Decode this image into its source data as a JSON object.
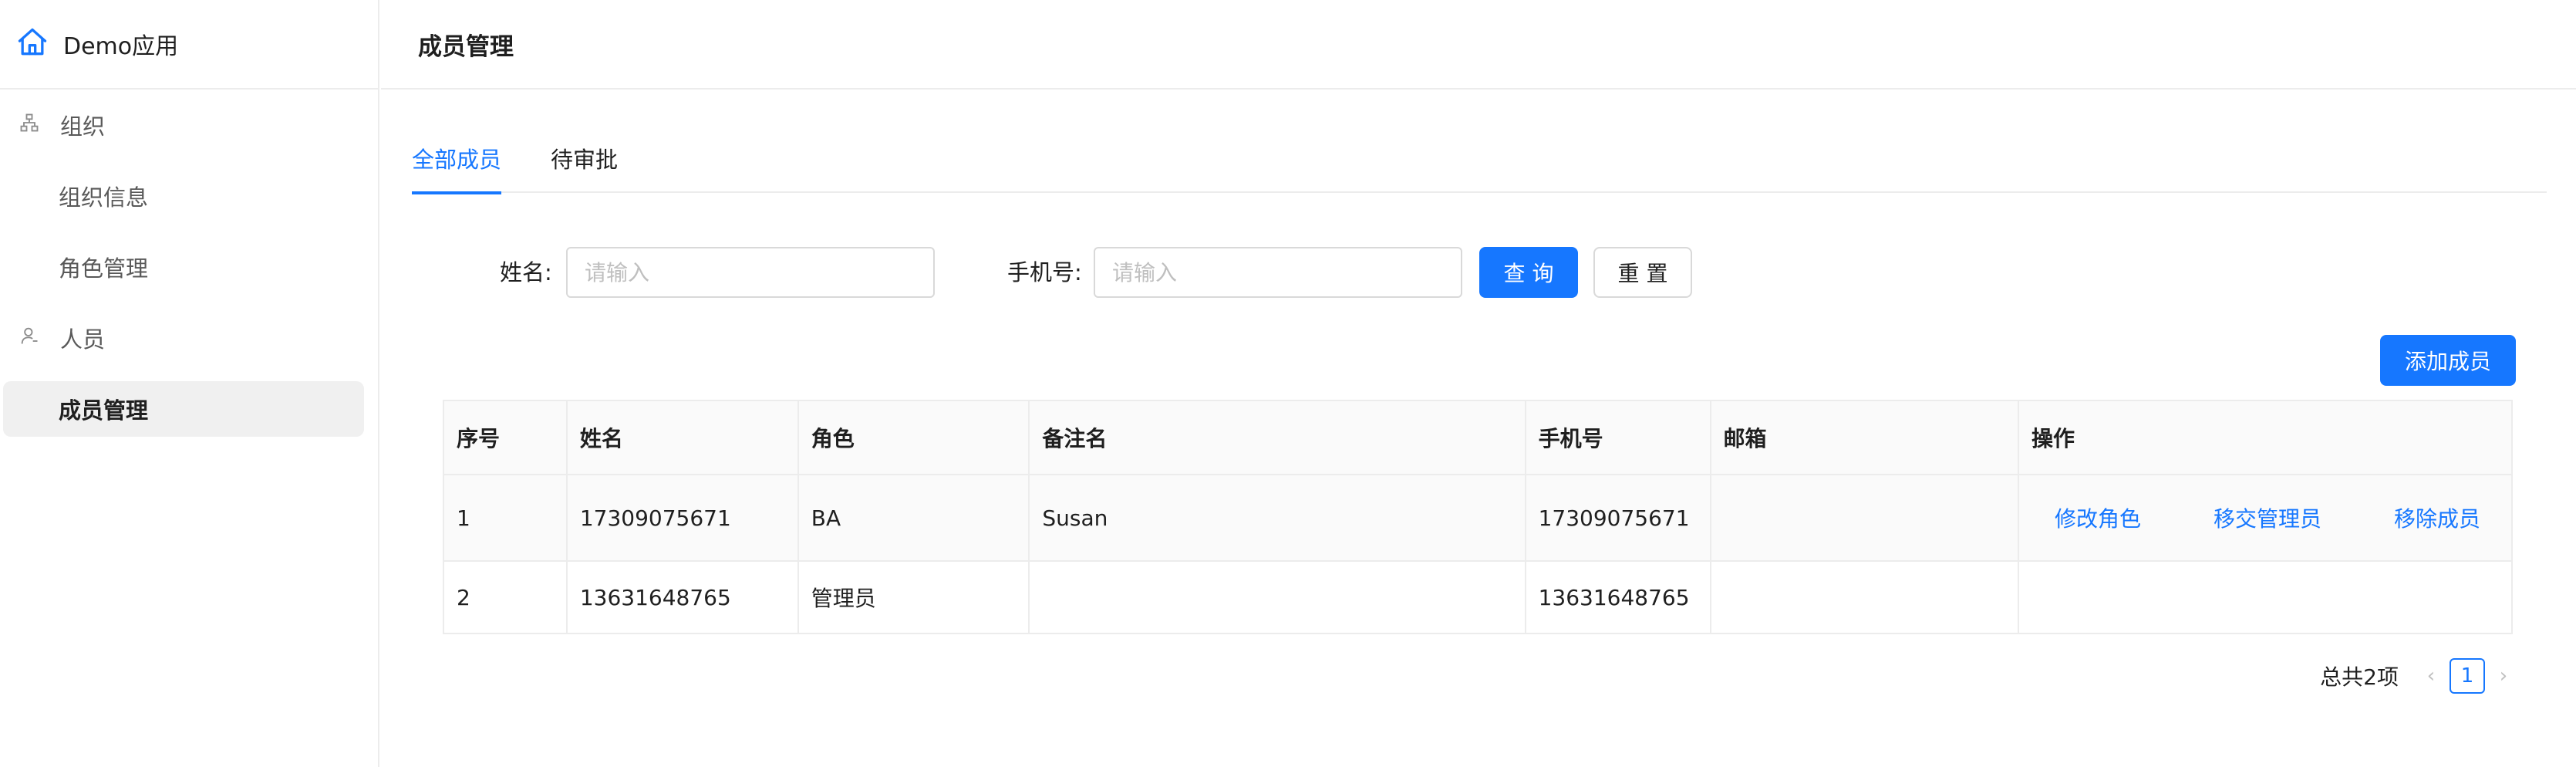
{
  "app": {
    "name": "Demo应用",
    "home_icon": "home-icon"
  },
  "sidebar": {
    "groups": [
      {
        "label": "组织",
        "icon": "org-tree-icon",
        "items": [
          {
            "label": "组织信息"
          },
          {
            "label": "角色管理"
          }
        ]
      },
      {
        "label": "人员",
        "icon": "user-icon",
        "items": [
          {
            "label": "成员管理",
            "active": true
          }
        ]
      }
    ]
  },
  "header": {
    "title": "成员管理"
  },
  "tabs": [
    {
      "label": "全部成员",
      "active": true
    },
    {
      "label": "待审批"
    }
  ],
  "filter": {
    "name_label": "姓名:",
    "name_placeholder": "请输入",
    "phone_label": "手机号:",
    "phone_placeholder": "请输入",
    "search_button": "查 询",
    "reset_button": "重 置"
  },
  "add_member_button": "添加成员",
  "table": {
    "columns": [
      "序号",
      "姓名",
      "角色",
      "备注名",
      "手机号",
      "邮箱",
      "操作"
    ],
    "rows": [
      {
        "index": "1",
        "name": "17309075671",
        "role": "BA",
        "remark": "Susan",
        "phone": "17309075671",
        "email": "",
        "actions": [
          "修改角色",
          "移交管理员",
          "移除成员"
        ]
      },
      {
        "index": "2",
        "name": "13631648765",
        "role": "管理员",
        "remark": "",
        "phone": "13631648765",
        "email": "",
        "actions": []
      }
    ]
  },
  "pagination": {
    "total_text": "总共2项",
    "current_page": "1",
    "prev_icon": "chevron-left-icon",
    "next_icon": "chevron-right-icon"
  },
  "colors": {
    "accent": "#1677ff"
  }
}
